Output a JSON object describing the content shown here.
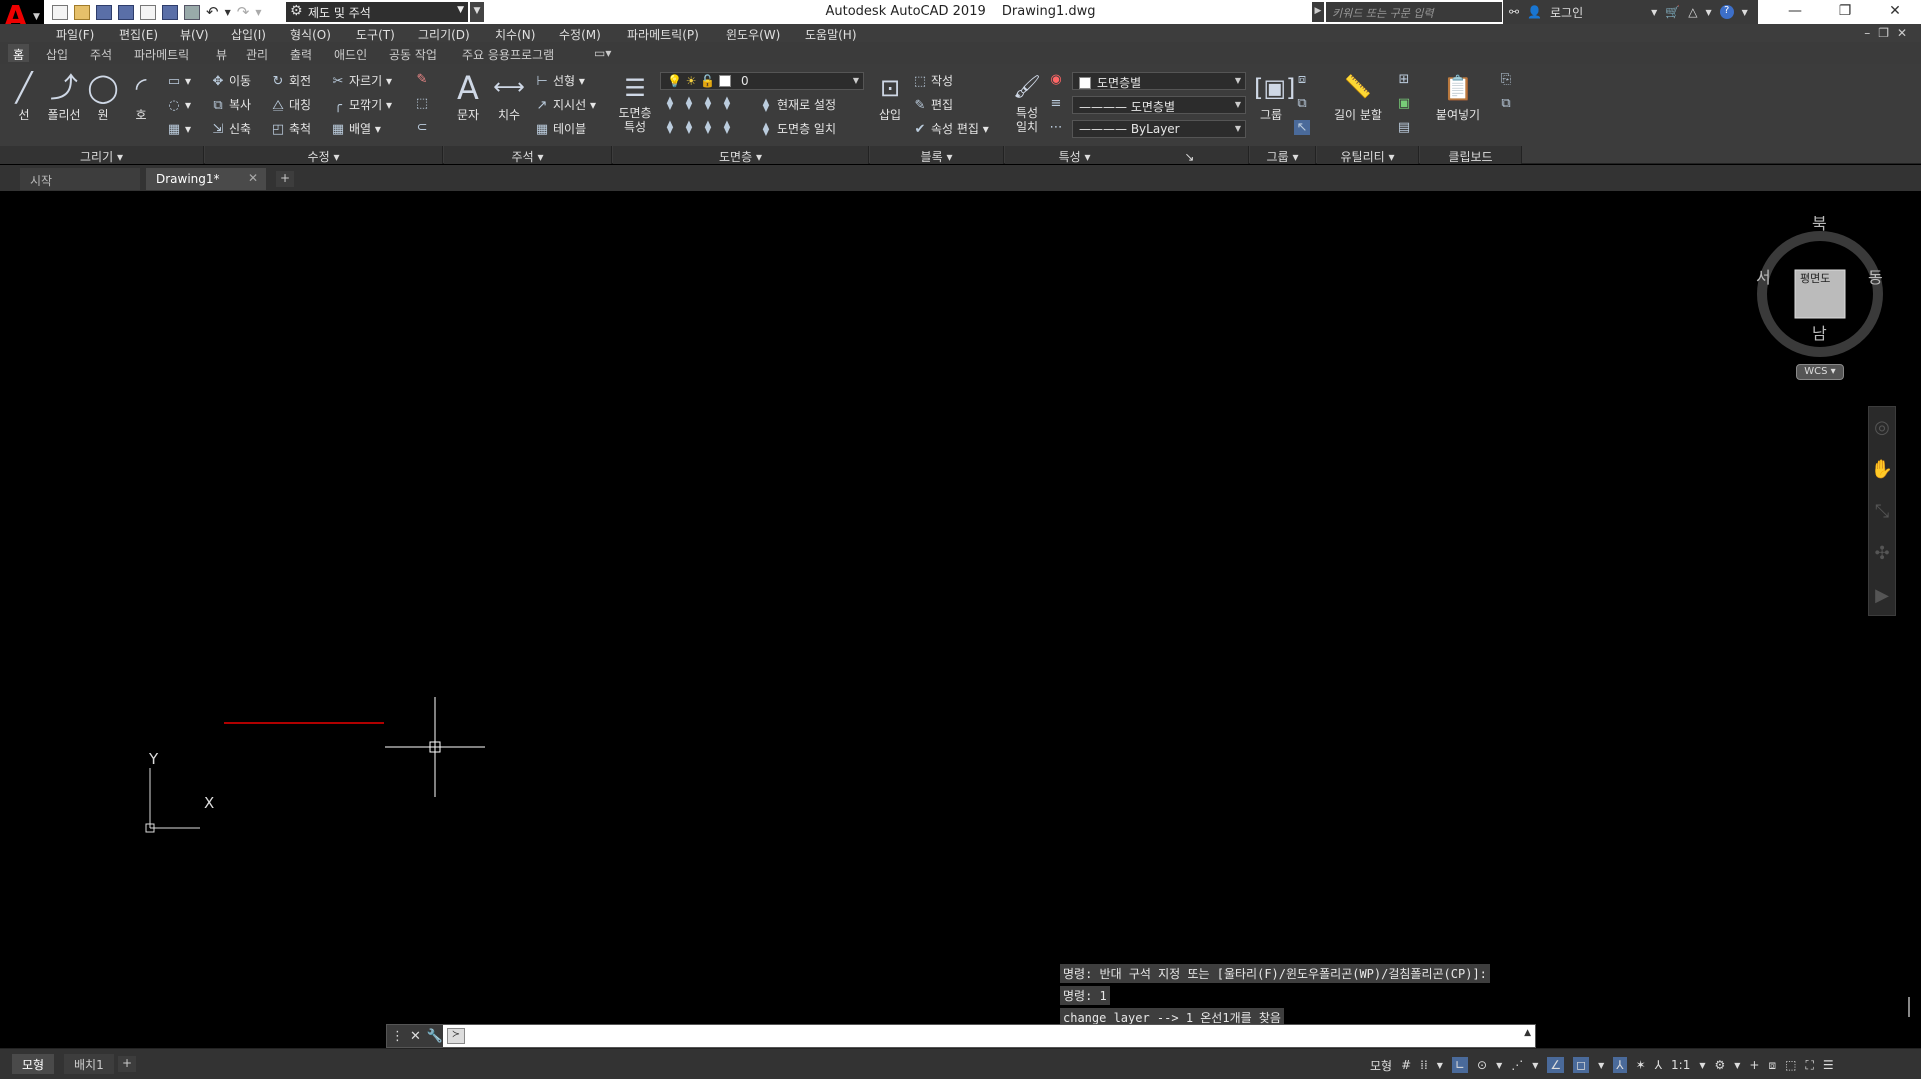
{
  "app": {
    "window_title": "Autodesk AutoCAD 2019",
    "document": "Drawing1.dwg",
    "workspace": "제도 및 주석",
    "search_placeholder": "키워드 또는 구문 입력",
    "login": "로그인"
  },
  "menu": [
    "파일(F)",
    "편집(E)",
    "뷰(V)",
    "삽입(I)",
    "형식(O)",
    "도구(T)",
    "그리기(D)",
    "치수(N)",
    "수정(M)",
    "파라메트릭(P)",
    "윈도우(W)",
    "도움말(H)"
  ],
  "ribbon_tabs": [
    "홈",
    "삽입",
    "주석",
    "파라메트릭",
    "뷰",
    "관리",
    "출력",
    "애드인",
    "공동 작업",
    "주요 응용프로그램"
  ],
  "ribbon": {
    "draw": {
      "line": "선",
      "polyline": "폴리선",
      "circle": "원",
      "arc": "호",
      "footer": "그리기"
    },
    "modify": {
      "move": "이동",
      "rotate": "회전",
      "trim": "자르기",
      "copy": "복사",
      "mirror": "대칭",
      "fillet": "모깎기",
      "stretch": "신축",
      "scale": "축척",
      "array": "배열",
      "footer": "수정"
    },
    "annotation": {
      "text": "문자",
      "dimension": "치수",
      "linear": "선형",
      "leader": "지시선",
      "table": "테이블",
      "footer": "주석"
    },
    "layers": {
      "props": "도면층 특성",
      "current_layer": "0",
      "make_current": "현재로 설정",
      "match": "도면층 일치",
      "footer": "도면층"
    },
    "block": {
      "insert": "삽입",
      "create": "작성",
      "edit": "편집",
      "edit_attr": "속성 편집",
      "footer": "블록"
    },
    "properties": {
      "match": "특성 일치",
      "color": "도면층별",
      "linetype": "도면층별",
      "lineweight": "ByLayer",
      "footer": "특성"
    },
    "groups": {
      "group": "그룹",
      "footer": "그룹"
    },
    "utilities": {
      "measure": "길이 분할",
      "footer": "유틸리티"
    },
    "clipboard": {
      "paste": "붙여넣기",
      "footer": "클립보드"
    }
  },
  "file_tabs": [
    {
      "label": "시작"
    },
    {
      "label": "Drawing1*"
    }
  ],
  "viewcube": {
    "north": "북",
    "south": "남",
    "east": "동",
    "west": "서",
    "face": "평면도",
    "wcs": "WCS"
  },
  "ucs": {
    "x": "X",
    "y": "Y"
  },
  "command_history": [
    "명령: 반대 구석 지정 또는 [울타리(F)/윈도우폴리곤(WP)/걸침폴리곤(CP)]:",
    "명령: 1",
    "change layer --> 1 온선1개를 찾음"
  ],
  "command_input": "",
  "layout_tabs": [
    "모형",
    "배치1"
  ],
  "status": {
    "model": "모형",
    "scale": "1:1"
  },
  "colors": {
    "accent": "#c8102e",
    "selected_line": "#b00000",
    "background": "#000000"
  }
}
